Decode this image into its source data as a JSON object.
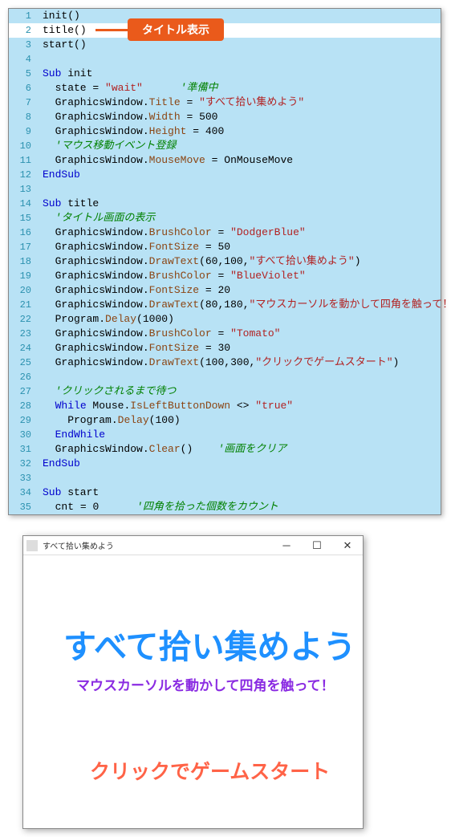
{
  "callout_label": "タイトル表示",
  "lines": [
    {
      "n": 1,
      "bg": "normal",
      "tokens": [
        {
          "t": "init",
          "c": "plain"
        },
        {
          "t": "()",
          "c": "punct"
        }
      ]
    },
    {
      "n": 2,
      "bg": "highlight",
      "tokens": [
        {
          "t": "title",
          "c": "plain"
        },
        {
          "t": "()",
          "c": "punct"
        }
      ]
    },
    {
      "n": 3,
      "bg": "normal",
      "tokens": [
        {
          "t": "start",
          "c": "plain"
        },
        {
          "t": "()",
          "c": "punct"
        }
      ]
    },
    {
      "n": 4,
      "bg": "normal",
      "tokens": []
    },
    {
      "n": 5,
      "bg": "normal",
      "tokens": [
        {
          "t": "Sub",
          "c": "kw"
        },
        {
          "t": " init",
          "c": "plain"
        }
      ]
    },
    {
      "n": 6,
      "bg": "normal",
      "tokens": [
        {
          "t": "  state ",
          "c": "plain"
        },
        {
          "t": "=",
          "c": "punct"
        },
        {
          "t": " ",
          "c": "plain"
        },
        {
          "t": "\"wait\"",
          "c": "str"
        },
        {
          "t": "      ",
          "c": "plain"
        },
        {
          "t": "'準備中",
          "c": "comment"
        }
      ]
    },
    {
      "n": 7,
      "bg": "normal",
      "tokens": [
        {
          "t": "  GraphicsWindow",
          "c": "plain"
        },
        {
          "t": ".",
          "c": "punct"
        },
        {
          "t": "Title",
          "c": "method"
        },
        {
          "t": " = ",
          "c": "punct"
        },
        {
          "t": "\"すべて拾い集めよう\"",
          "c": "str"
        }
      ]
    },
    {
      "n": 8,
      "bg": "normal",
      "tokens": [
        {
          "t": "  GraphicsWindow",
          "c": "plain"
        },
        {
          "t": ".",
          "c": "punct"
        },
        {
          "t": "Width",
          "c": "method"
        },
        {
          "t": " = ",
          "c": "punct"
        },
        {
          "t": "500",
          "c": "num"
        }
      ]
    },
    {
      "n": 9,
      "bg": "normal",
      "tokens": [
        {
          "t": "  GraphicsWindow",
          "c": "plain"
        },
        {
          "t": ".",
          "c": "punct"
        },
        {
          "t": "Height",
          "c": "method"
        },
        {
          "t": " = ",
          "c": "punct"
        },
        {
          "t": "400",
          "c": "num"
        }
      ]
    },
    {
      "n": 10,
      "bg": "normal",
      "tokens": [
        {
          "t": "  ",
          "c": "plain"
        },
        {
          "t": "'マウス移動イベント登録",
          "c": "comment"
        }
      ]
    },
    {
      "n": 11,
      "bg": "normal",
      "tokens": [
        {
          "t": "  GraphicsWindow",
          "c": "plain"
        },
        {
          "t": ".",
          "c": "punct"
        },
        {
          "t": "MouseMove",
          "c": "method"
        },
        {
          "t": " = ",
          "c": "punct"
        },
        {
          "t": "OnMouseMove",
          "c": "plain"
        }
      ]
    },
    {
      "n": 12,
      "bg": "normal",
      "tokens": [
        {
          "t": "EndSub",
          "c": "kw"
        }
      ]
    },
    {
      "n": 13,
      "bg": "normal",
      "tokens": []
    },
    {
      "n": 14,
      "bg": "normal",
      "tokens": [
        {
          "t": "Sub",
          "c": "kw"
        },
        {
          "t": " title",
          "c": "plain"
        }
      ]
    },
    {
      "n": 15,
      "bg": "normal",
      "tokens": [
        {
          "t": "  ",
          "c": "plain"
        },
        {
          "t": "'タイトル画面の表示",
          "c": "comment"
        }
      ]
    },
    {
      "n": 16,
      "bg": "normal",
      "tokens": [
        {
          "t": "  GraphicsWindow",
          "c": "plain"
        },
        {
          "t": ".",
          "c": "punct"
        },
        {
          "t": "BrushColor",
          "c": "method"
        },
        {
          "t": " = ",
          "c": "punct"
        },
        {
          "t": "\"DodgerBlue\"",
          "c": "str"
        }
      ]
    },
    {
      "n": 17,
      "bg": "normal",
      "tokens": [
        {
          "t": "  GraphicsWindow",
          "c": "plain"
        },
        {
          "t": ".",
          "c": "punct"
        },
        {
          "t": "FontSize",
          "c": "method"
        },
        {
          "t": " = ",
          "c": "punct"
        },
        {
          "t": "50",
          "c": "num"
        }
      ]
    },
    {
      "n": 18,
      "bg": "normal",
      "tokens": [
        {
          "t": "  GraphicsWindow",
          "c": "plain"
        },
        {
          "t": ".",
          "c": "punct"
        },
        {
          "t": "DrawText",
          "c": "method"
        },
        {
          "t": "(",
          "c": "punct"
        },
        {
          "t": "60",
          "c": "num"
        },
        {
          "t": ",",
          "c": "punct"
        },
        {
          "t": "100",
          "c": "num"
        },
        {
          "t": ",",
          "c": "punct"
        },
        {
          "t": "\"すべて拾い集めよう\"",
          "c": "str"
        },
        {
          "t": ")",
          "c": "punct"
        }
      ]
    },
    {
      "n": 19,
      "bg": "normal",
      "tokens": [
        {
          "t": "  GraphicsWindow",
          "c": "plain"
        },
        {
          "t": ".",
          "c": "punct"
        },
        {
          "t": "BrushColor",
          "c": "method"
        },
        {
          "t": " = ",
          "c": "punct"
        },
        {
          "t": "\"BlueViolet\"",
          "c": "str"
        }
      ]
    },
    {
      "n": 20,
      "bg": "normal",
      "tokens": [
        {
          "t": "  GraphicsWindow",
          "c": "plain"
        },
        {
          "t": ".",
          "c": "punct"
        },
        {
          "t": "FontSize",
          "c": "method"
        },
        {
          "t": " = ",
          "c": "punct"
        },
        {
          "t": "20",
          "c": "num"
        }
      ]
    },
    {
      "n": 21,
      "bg": "normal",
      "tokens": [
        {
          "t": "  GraphicsWindow",
          "c": "plain"
        },
        {
          "t": ".",
          "c": "punct"
        },
        {
          "t": "DrawText",
          "c": "method"
        },
        {
          "t": "(",
          "c": "punct"
        },
        {
          "t": "80",
          "c": "num"
        },
        {
          "t": ",",
          "c": "punct"
        },
        {
          "t": "180",
          "c": "num"
        },
        {
          "t": ",",
          "c": "punct"
        },
        {
          "t": "\"マウスカーソルを動かして四角を触って！\"",
          "c": "str"
        },
        {
          "t": ")",
          "c": "punct"
        }
      ]
    },
    {
      "n": 22,
      "bg": "normal",
      "tokens": [
        {
          "t": "  Program",
          "c": "plain"
        },
        {
          "t": ".",
          "c": "punct"
        },
        {
          "t": "Delay",
          "c": "method"
        },
        {
          "t": "(",
          "c": "punct"
        },
        {
          "t": "1000",
          "c": "num"
        },
        {
          "t": ")",
          "c": "punct"
        }
      ]
    },
    {
      "n": 23,
      "bg": "normal",
      "tokens": [
        {
          "t": "  GraphicsWindow",
          "c": "plain"
        },
        {
          "t": ".",
          "c": "punct"
        },
        {
          "t": "BrushColor",
          "c": "method"
        },
        {
          "t": " = ",
          "c": "punct"
        },
        {
          "t": "\"Tomato\"",
          "c": "str"
        }
      ]
    },
    {
      "n": 24,
      "bg": "normal",
      "tokens": [
        {
          "t": "  GraphicsWindow",
          "c": "plain"
        },
        {
          "t": ".",
          "c": "punct"
        },
        {
          "t": "FontSize",
          "c": "method"
        },
        {
          "t": " = ",
          "c": "punct"
        },
        {
          "t": "30",
          "c": "num"
        }
      ]
    },
    {
      "n": 25,
      "bg": "normal",
      "tokens": [
        {
          "t": "  GraphicsWindow",
          "c": "plain"
        },
        {
          "t": ".",
          "c": "punct"
        },
        {
          "t": "DrawText",
          "c": "method"
        },
        {
          "t": "(",
          "c": "punct"
        },
        {
          "t": "100",
          "c": "num"
        },
        {
          "t": ",",
          "c": "punct"
        },
        {
          "t": "300",
          "c": "num"
        },
        {
          "t": ",",
          "c": "punct"
        },
        {
          "t": "\"クリックでゲームスタート\"",
          "c": "str"
        },
        {
          "t": ")",
          "c": "punct"
        }
      ]
    },
    {
      "n": 26,
      "bg": "normal",
      "tokens": []
    },
    {
      "n": 27,
      "bg": "normal",
      "tokens": [
        {
          "t": "  ",
          "c": "plain"
        },
        {
          "t": "'クリックされるまで待つ",
          "c": "comment"
        }
      ]
    },
    {
      "n": 28,
      "bg": "normal",
      "tokens": [
        {
          "t": "  ",
          "c": "plain"
        },
        {
          "t": "While",
          "c": "kw"
        },
        {
          "t": " Mouse",
          "c": "plain"
        },
        {
          "t": ".",
          "c": "punct"
        },
        {
          "t": "IsLeftButtonDown",
          "c": "method"
        },
        {
          "t": " <> ",
          "c": "punct"
        },
        {
          "t": "\"true\"",
          "c": "str"
        }
      ]
    },
    {
      "n": 29,
      "bg": "normal",
      "tokens": [
        {
          "t": "    Program",
          "c": "plain"
        },
        {
          "t": ".",
          "c": "punct"
        },
        {
          "t": "Delay",
          "c": "method"
        },
        {
          "t": "(",
          "c": "punct"
        },
        {
          "t": "100",
          "c": "num"
        },
        {
          "t": ")",
          "c": "punct"
        }
      ]
    },
    {
      "n": 30,
      "bg": "normal",
      "tokens": [
        {
          "t": "  ",
          "c": "plain"
        },
        {
          "t": "EndWhile",
          "c": "kw"
        }
      ]
    },
    {
      "n": 31,
      "bg": "normal",
      "tokens": [
        {
          "t": "  GraphicsWindow",
          "c": "plain"
        },
        {
          "t": ".",
          "c": "punct"
        },
        {
          "t": "Clear",
          "c": "method"
        },
        {
          "t": "()    ",
          "c": "punct"
        },
        {
          "t": "'画面をクリア",
          "c": "comment"
        }
      ]
    },
    {
      "n": 32,
      "bg": "normal",
      "tokens": [
        {
          "t": "EndSub",
          "c": "kw"
        }
      ]
    },
    {
      "n": 33,
      "bg": "normal",
      "tokens": []
    },
    {
      "n": 34,
      "bg": "normal",
      "tokens": [
        {
          "t": "Sub",
          "c": "kw"
        },
        {
          "t": " start",
          "c": "plain"
        }
      ]
    },
    {
      "n": 35,
      "bg": "normal",
      "tokens": [
        {
          "t": "  cnt ",
          "c": "plain"
        },
        {
          "t": "=",
          "c": "punct"
        },
        {
          "t": " ",
          "c": "plain"
        },
        {
          "t": "0",
          "c": "num"
        },
        {
          "t": "      ",
          "c": "plain"
        },
        {
          "t": "'四角を拾った個数をカウント",
          "c": "comment"
        }
      ]
    }
  ],
  "window": {
    "title": "すべて拾い集めよう",
    "ctrl_min": "─",
    "ctrl_max": "☐",
    "ctrl_close": "✕",
    "text1": "すべて拾い集めよう",
    "text2": "マウスカーソルを動かして四角を触って！",
    "text3": "クリックでゲームスタート"
  }
}
